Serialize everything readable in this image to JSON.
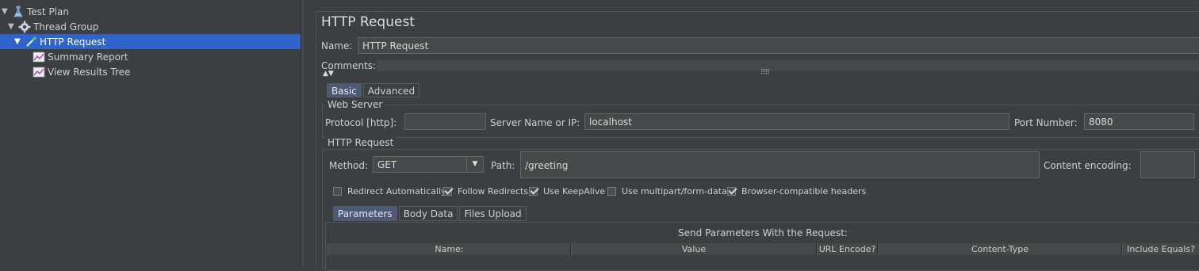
{
  "tree": {
    "items": [
      {
        "label": "Test Plan",
        "icon": "test-plan-icon"
      },
      {
        "label": "Thread Group",
        "icon": "gear-icon"
      },
      {
        "label": "HTTP Request",
        "icon": "pipette-icon"
      },
      {
        "label": "Summary Report",
        "icon": "chart-icon"
      },
      {
        "label": "View Results Tree",
        "icon": "chart-icon"
      }
    ]
  },
  "panel": {
    "title": "HTTP Request",
    "name_label": "Name:",
    "name_value": "HTTP Request",
    "comments_label": "Comments:",
    "tabs": [
      "Basic",
      "Advanced"
    ],
    "web_server": {
      "title": "Web Server",
      "protocol_label": "Protocol [http]:",
      "protocol_value": "",
      "server_label": "Server Name or IP:",
      "server_value": "localhost",
      "port_label": "Port Number:",
      "port_value": "8080"
    },
    "http_request": {
      "title": "HTTP Request",
      "method_label": "Method:",
      "method_value": "GET",
      "path_label": "Path:",
      "path_value": "/greeting",
      "encoding_label": "Content encoding:",
      "encoding_value": ""
    },
    "checkboxes": [
      {
        "label": "Redirect Automatically",
        "checked": false
      },
      {
        "label": "Follow Redirects",
        "checked": true
      },
      {
        "label": "Use KeepAlive",
        "checked": true
      },
      {
        "label": "Use multipart/form-data",
        "checked": false
      },
      {
        "label": "Browser-compatible headers",
        "checked": true
      }
    ],
    "param_tabs": [
      "Parameters",
      "Body Data",
      "Files Upload"
    ],
    "params": {
      "heading": "Send Parameters With the Request:",
      "columns": [
        "Name:",
        "Value",
        "URL Encode?",
        "Content-Type",
        "Include Equals?"
      ]
    }
  }
}
